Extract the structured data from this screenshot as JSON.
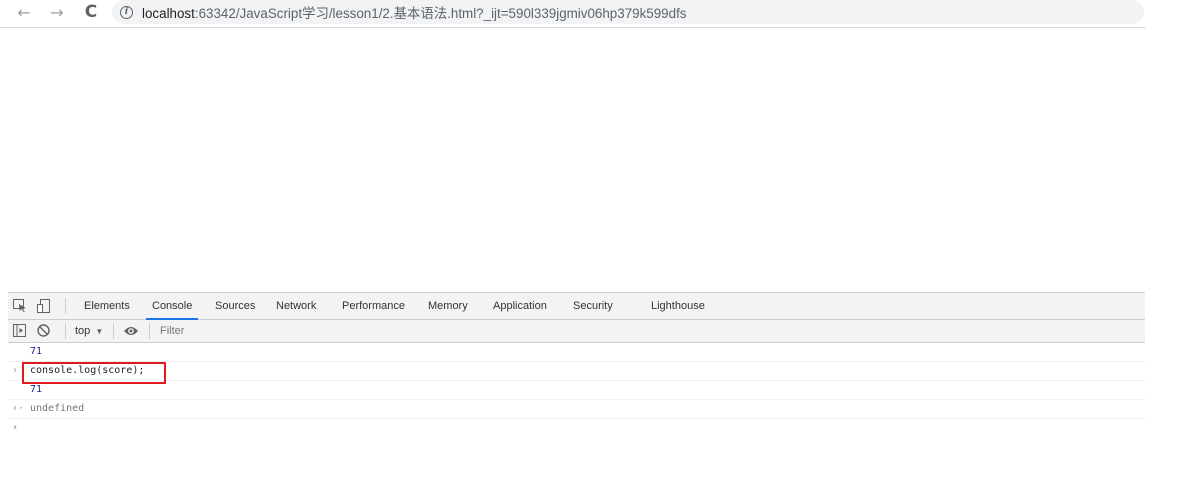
{
  "browser": {
    "back_glyph": "←",
    "forward_glyph": "→",
    "reload_glyph": "C",
    "info_glyph": "i",
    "url_host": "localhost",
    "url_rest": ":63342/JavaScript学习/lesson1/2.基本语法.html?_ijt=590l339jgmiv06hp379k599dfs"
  },
  "devtools": {
    "tabs": [
      "Elements",
      "Console",
      "Sources",
      "Network",
      "Performance",
      "Memory",
      "Application",
      "Security",
      "Lighthouse"
    ],
    "active_tab": "Console",
    "context": "top",
    "context_arrow": "▼",
    "filter_placeholder": "Filter"
  },
  "console": {
    "lines": [
      {
        "type": "output",
        "gutter": "",
        "text": "71"
      },
      {
        "type": "input",
        "gutter": "›",
        "text": "console.log(score);"
      },
      {
        "type": "output",
        "gutter": "",
        "text": "71"
      },
      {
        "type": "result",
        "gutter": "‹·",
        "text": "undefined"
      },
      {
        "type": "prompt",
        "gutter": "›",
        "text": ""
      }
    ]
  },
  "colors": {
    "accent": "#1a73e8",
    "highlight_box": "#e0191e",
    "number": "#1a1aa6"
  }
}
